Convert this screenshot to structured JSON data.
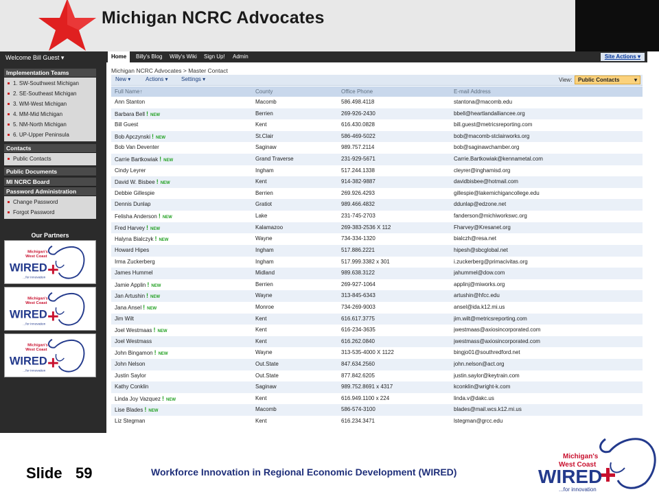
{
  "header": {
    "title": "Michigan NCRC Advocates"
  },
  "sidebar": {
    "welcome": "Welcome Bill Guest",
    "groups": [
      {
        "title": "Implementation Teams",
        "items": [
          "1. SW-Southwest Michigan",
          "2. SE-Southeast Michigan",
          "3. WM-West Michigan",
          "4. MM-Mid Michigan",
          "5. NM-North Michigan",
          "6. UP-Upper Peninsula"
        ]
      },
      {
        "title": "Contacts",
        "items": [
          "Public Contacts"
        ]
      },
      {
        "title": "Public Documents",
        "items": []
      },
      {
        "title": "MI NCRC Board",
        "items": []
      },
      {
        "title": "Password Administration",
        "items": [
          "Change Password",
          "Forgot Password"
        ]
      }
    ],
    "partners_title": "Our Partners",
    "partner_logo_text": [
      "Michigan's",
      "West Coast",
      "WIRED",
      "...for innovation"
    ]
  },
  "topnav": {
    "tabs": [
      "Home",
      "Billy's Blog",
      "Willy's Wiki",
      "Sign Up!",
      "Admin"
    ],
    "site_actions": "Site Actions"
  },
  "breadcrumb": "Michigan NCRC Advocates > Master Contact",
  "toolbar": {
    "new": "New",
    "actions": "Actions",
    "settings": "Settings",
    "view_label": "View:",
    "view_value": "Public Contacts"
  },
  "list": {
    "columns": [
      "Full Name",
      "County",
      "Office Phone",
      "E-mail Address"
    ],
    "new_label": "NEW",
    "rows": [
      {
        "name": "Ann Stanton",
        "county": "Macomb",
        "phone": "586.498.4118",
        "email": "stantona@macomb.edu",
        "is_new": false
      },
      {
        "name": "Barbara Bell",
        "county": "Berrien",
        "phone": "269-926-2430",
        "email": "bbell@heartlandalliancee.org",
        "is_new": true
      },
      {
        "name": "Bill Guest",
        "county": "Kent",
        "phone": "616.430.0828",
        "email": "bill.guest@metricsreporting.com",
        "is_new": false
      },
      {
        "name": "Bob Apczynski",
        "county": "St.Clair",
        "phone": "586-469-5022",
        "email": "bob@macomb-stclairworks.org",
        "is_new": true
      },
      {
        "name": "Bob Van Deventer",
        "county": "Saginaw",
        "phone": "989.757.2114",
        "email": "bob@saginawchamber.org",
        "is_new": false
      },
      {
        "name": "Carrie Bartkowiak",
        "county": "Grand Traverse",
        "phone": "231-929-5671",
        "email": "Carrie.Bartkowiak@kennametal.com",
        "is_new": true
      },
      {
        "name": "Cindy Leyrer",
        "county": "Ingham",
        "phone": "517.244.1338",
        "email": "cleyrer@inghamisd.org",
        "is_new": false
      },
      {
        "name": "David W. Bisbee",
        "county": "Kent",
        "phone": "914-382-9887",
        "email": "davidbisbee@hotmail.com",
        "is_new": true
      },
      {
        "name": "Debbie Gillespie",
        "county": "Berrien",
        "phone": "269.926.4293",
        "email": "gillespie@lakemichigancollege.edu",
        "is_new": false
      },
      {
        "name": "Dennis Dunlap",
        "county": "Gratiot",
        "phone": "989.466.4832",
        "email": "ddunlap@edzone.net",
        "is_new": false
      },
      {
        "name": "Felisha Anderson",
        "county": "Lake",
        "phone": "231-745-2703",
        "email": "fanderson@michiworkswc.org",
        "is_new": true
      },
      {
        "name": "Fred Harvey",
        "county": "Kalamazoo",
        "phone": "269-383-2536 X 112",
        "email": "Fharvey@Kresanet.org",
        "is_new": true
      },
      {
        "name": "Halyna Bialczyk",
        "county": "Wayne",
        "phone": "734-334-1320",
        "email": "bialczh@resa.net",
        "is_new": true
      },
      {
        "name": "Howard Hipes",
        "county": "Ingham",
        "phone": "517.886.2221",
        "email": "hipesh@sbcglobal.net",
        "is_new": false
      },
      {
        "name": "Irma Zuckerberg",
        "county": "Ingham",
        "phone": "517.999.3382 x 301",
        "email": "i.zuckerberg@primacivitas.org",
        "is_new": false
      },
      {
        "name": "James Hummel",
        "county": "Midland",
        "phone": "989.638.3122",
        "email": "jahummel@dow.com",
        "is_new": false
      },
      {
        "name": "Jamie Applin",
        "county": "Berrien",
        "phone": "269-927-1064",
        "email": "applinj@miworks.org",
        "is_new": true
      },
      {
        "name": "Jan Artushin",
        "county": "Wayne",
        "phone": "313-845-6343",
        "email": "artushin@hfcc.edu",
        "is_new": true
      },
      {
        "name": "Jana Ansel",
        "county": "Monroe",
        "phone": "734-269-9003",
        "email": "ansel@ida.k12.mi.us",
        "is_new": true
      },
      {
        "name": "Jim Wilt",
        "county": "Kent",
        "phone": "616.617.3775",
        "email": "jim.wilt@metricsreporting.com",
        "is_new": false
      },
      {
        "name": "Joel Westmaas",
        "county": "Kent",
        "phone": "616-234-3635",
        "email": "jwestmaas@axiosincorporated.com",
        "is_new": true
      },
      {
        "name": "Joel Westmass",
        "county": "Kent",
        "phone": "616.262.0840",
        "email": "jwestmass@axiosincorporated.com",
        "is_new": false
      },
      {
        "name": "John Bingamon",
        "county": "Wayne",
        "phone": "313-535-4000 X 1122",
        "email": "bingjo01@southredford.net",
        "is_new": true
      },
      {
        "name": "John Nelson",
        "county": "Out.State",
        "phone": "847.634.2560",
        "email": "john.nelson@act.org",
        "is_new": false
      },
      {
        "name": "Justin Saylor",
        "county": "Out.State",
        "phone": "877.842.6205",
        "email": "justin.saylor@keytrain.com",
        "is_new": false
      },
      {
        "name": "Kathy Conklin",
        "county": "Saginaw",
        "phone": "989.752.8691 x 4317",
        "email": "kconklin@wright-k.com",
        "is_new": false
      },
      {
        "name": "Linda Joy Vazquez",
        "county": "Kent",
        "phone": "616.949.1100 x 224",
        "email": "linda.v@dakc.us",
        "is_new": true
      },
      {
        "name": "Lise Blades",
        "county": "Macomb",
        "phone": "586-574-3100",
        "email": "blades@mail.wcs.k12.mi.us",
        "is_new": true
      },
      {
        "name": "Liz Stegman",
        "county": "Kent",
        "phone": "616.234.3471",
        "email": "lstegman@grcc.edu",
        "is_new": false
      }
    ]
  },
  "footer": {
    "slide_label": "Slide",
    "slide_number": "59",
    "caption": "Workforce Innovation in Regional Economic Development (WIRED)"
  },
  "colors": {
    "star": "#e02020",
    "wired_blue": "#233a8c",
    "wired_red": "#c8102e",
    "toolbar": "#dfe8f3",
    "view_select": "#fbd27c"
  }
}
